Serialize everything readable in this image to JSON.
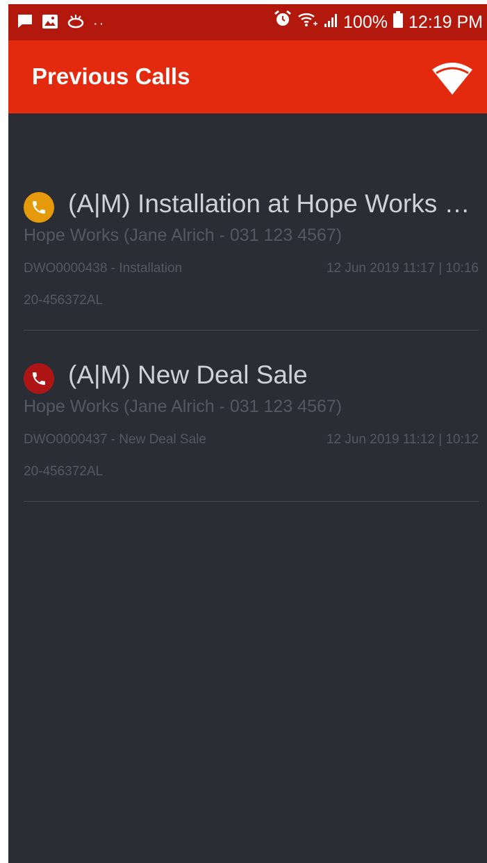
{
  "status_bar": {
    "battery": "100%",
    "time": "12:19 PM",
    "dots": "··",
    "icons": [
      "message-icon",
      "image-icon",
      "chat-bubbles-icon",
      "alarm-icon",
      "wifi-status-icon",
      "signal-icon",
      "battery-icon"
    ]
  },
  "app_bar": {
    "title": "Previous Calls",
    "action_icon": "wifi-icon"
  },
  "colors": {
    "app_bar": "#e42a0e",
    "status_bar": "#b3180d",
    "background": "#2b2d35",
    "call_orange": "#e59a0c",
    "call_red": "#b01515"
  },
  "calls": [
    {
      "icon": "phone-icon",
      "status_color": "#e59a0c",
      "title": "(A|M) Installation at Hope Works D…",
      "contact": "Hope Works (Jane Alrich - 031 123 4567)",
      "reference": "DWO0000438 - Installation",
      "timestamp": "12 Jun 2019 11:17 | 10:16",
      "code": "20-456372AL"
    },
    {
      "icon": "phone-icon",
      "status_color": "#b01515",
      "title": "(A|M) New Deal Sale",
      "contact": "Hope Works (Jane Alrich - 031 123 4567)",
      "reference": "DWO0000437 - New Deal Sale",
      "timestamp": "12 Jun 2019 11:12 | 10:12",
      "code": "20-456372AL"
    }
  ]
}
